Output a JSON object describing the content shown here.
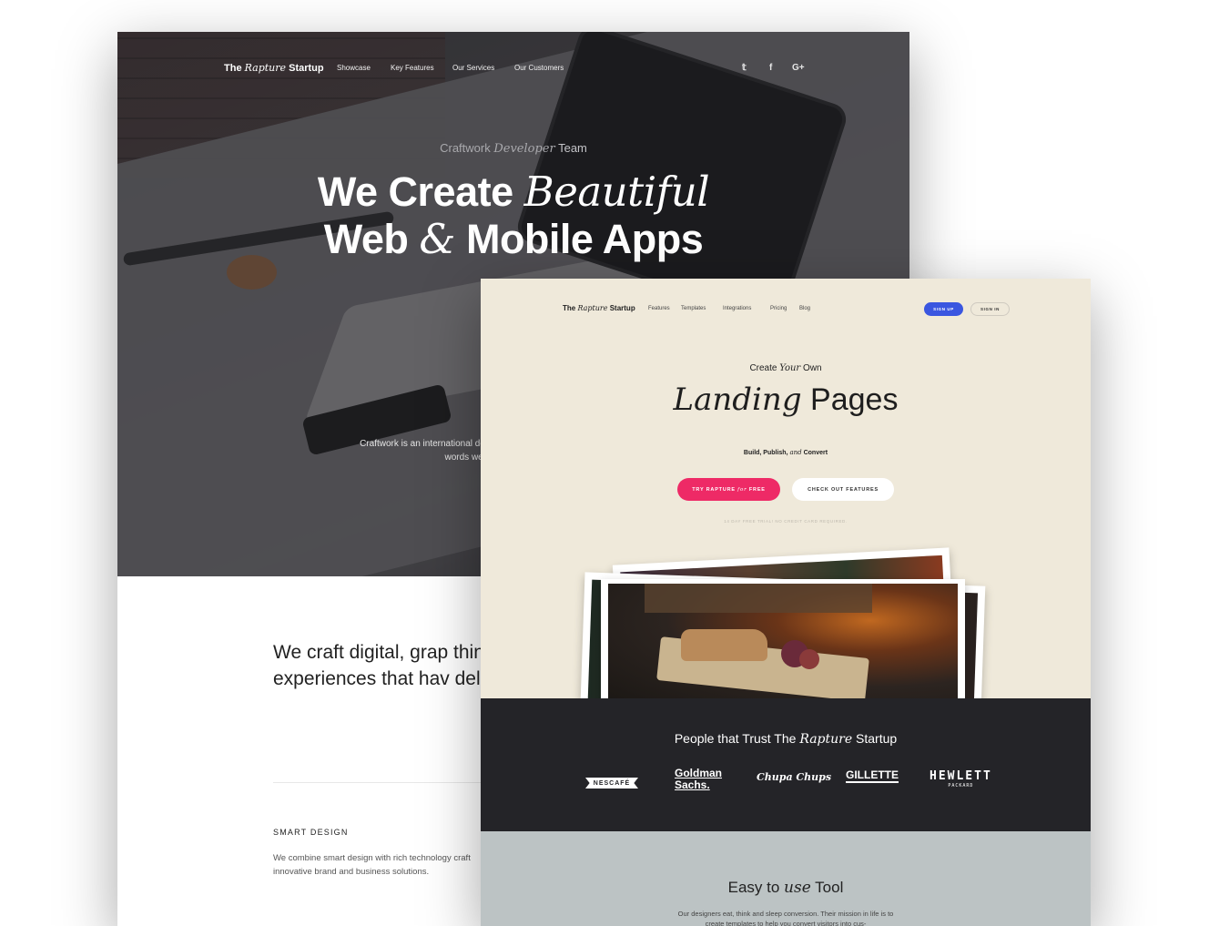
{
  "back_page": {
    "brand": {
      "pre": "The ",
      "italic": "Rapture",
      "post": " Startup"
    },
    "nav": [
      "Showcase",
      "Key Features",
      "Our Services",
      "Our Customers"
    ],
    "social": [
      "twitter-icon",
      "facebook-icon",
      "google-plus-icon"
    ],
    "social_glyphs": [
      "𝕥",
      "f",
      "G+"
    ],
    "hero": {
      "eyebrow_pre": "Craftwork ",
      "eyebrow_italic": "Developer",
      "eyebrow_post": " Team",
      "line1_pre": "We Create ",
      "line1_italic": "Beautiful",
      "line2_pre": "Web ",
      "line2_italic": "&",
      "line2_post": " Mobile Apps",
      "desc": "Craftwork is an international de in creating and supporting inn words we make aw"
    },
    "lead": "We craft digital, grap thinking, to create ca experiences that hav deliver extraordinary",
    "section_title": "SMART DESIGN",
    "section_text": "We combine smart design with rich technology craft innovative brand and business solutions."
  },
  "front_page": {
    "brand": {
      "pre": "The ",
      "italic": "Rapture",
      "post": " Startup"
    },
    "nav": [
      "Features",
      "Templates",
      "Integrations",
      "Pricing",
      "Blog"
    ],
    "sign_up": "SIGN UP",
    "sign_in": "SIGN IN",
    "eyebrow_pre": "Create ",
    "eyebrow_italic": "Your",
    "eyebrow_post": " Own",
    "title_italic": "Landing",
    "title_post": " Pages",
    "sub_pre": "Build, Publish, ",
    "sub_italic": "and",
    "sub_post": " Convert",
    "cta_primary_pre": "TRY RAPTURE ",
    "cta_primary_italic": "for",
    "cta_primary_post": " FREE",
    "cta_secondary": "CHECK OUT FEATURES",
    "trial_note": "14 DAY FREE TRIAL! NO CREDIT CARD REQUIRED.",
    "trust_title_pre": "People that Trust The ",
    "trust_title_italic": "Rapture",
    "trust_title_post": " Startup",
    "logos": {
      "nescafe": "NESCAFÉ",
      "goldman_1": "Goldman",
      "goldman_2": "Sachs.",
      "chupa": "Chupa Chups",
      "gillette": "GILLETTE",
      "hp_1": "HEWLETT",
      "hp_2": "PACKARD"
    },
    "easy_title_pre": "Easy to ",
    "easy_title_italic": "use",
    "easy_title_post": " Tool",
    "easy_text": "Our designers eat, think and sleep conversion. Their mission in life is to create templates to help you convert visitors into cus-"
  },
  "colors": {
    "sign_up": "#3a56e0",
    "cta_primary": "#ee2a66",
    "front_bg": "#efe9da",
    "trust_bg": "#242428",
    "easy_bg": "#bcc3c4"
  }
}
